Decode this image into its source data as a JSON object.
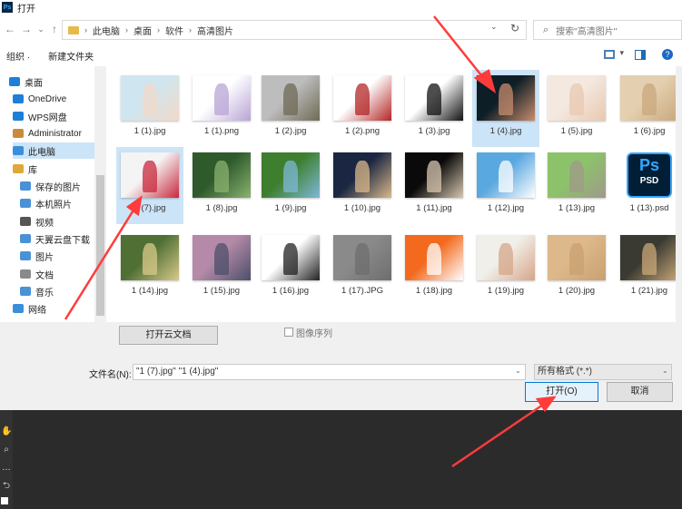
{
  "window": {
    "title": "打开",
    "app_icon": "Ps"
  },
  "address": {
    "breadcrumbs": [
      "此电脑",
      "桌面",
      "软件",
      "高清图片"
    ],
    "search_placeholder": "搜索\"高清图片\""
  },
  "toolbar": {
    "organize": "组织 ·",
    "new_folder": "新建文件夹"
  },
  "sidebar": {
    "items": [
      {
        "label": "桌面",
        "icon": "desktop-icon",
        "color": "#1d7fd8"
      },
      {
        "label": "OneDrive",
        "icon": "cloud-icon",
        "color": "#1d7fd8"
      },
      {
        "label": "WPS网盘",
        "icon": "cloud-icon",
        "color": "#1d7fd8"
      },
      {
        "label": "Administrator",
        "icon": "user-icon",
        "color": "#c98b3b"
      },
      {
        "label": "此电脑",
        "icon": "computer-icon",
        "color": "#3a8fd9"
      },
      {
        "label": "库",
        "icon": "library-icon",
        "color": "#e0a73a"
      },
      {
        "label": "保存的图片",
        "icon": "pictures-icon",
        "color": "#4b91d6"
      },
      {
        "label": "本机照片",
        "icon": "pictures-icon",
        "color": "#4b91d6"
      },
      {
        "label": "视频",
        "icon": "video-icon",
        "color": "#555555"
      },
      {
        "label": "天翼云盘下载",
        "icon": "folder-icon",
        "color": "#4b91d6"
      },
      {
        "label": "图片",
        "icon": "pictures-icon",
        "color": "#4b91d6"
      },
      {
        "label": "文档",
        "icon": "document-icon",
        "color": "#8a8a8a"
      },
      {
        "label": "音乐",
        "icon": "music-icon",
        "color": "#4b91d6"
      },
      {
        "label": "网络",
        "icon": "network-icon",
        "color": "#3a8fd9"
      }
    ]
  },
  "files": [
    {
      "name": "1 (1).jpg",
      "colors": [
        "#cfe6f0",
        "#f2d9c9"
      ],
      "selected": false
    },
    {
      "name": "1 (1).png",
      "colors": [
        "#ffffff",
        "#b8a4d6"
      ],
      "selected": false
    },
    {
      "name": "1 (2).jpg",
      "colors": [
        "#bdbdbd",
        "#6f6a55"
      ],
      "selected": false
    },
    {
      "name": "1 (2).png",
      "colors": [
        "#ffffff",
        "#b32626"
      ],
      "selected": false
    },
    {
      "name": "1 (3).jpg",
      "colors": [
        "#ffffff",
        "#111111"
      ],
      "selected": false
    },
    {
      "name": "1 (4).jpg",
      "colors": [
        "#0d1e26",
        "#c98c6e"
      ],
      "selected": true
    },
    {
      "name": "1 (5).jpg",
      "colors": [
        "#f4e9e0",
        "#e9c8b0"
      ],
      "selected": false
    },
    {
      "name": "1 (6).jpg",
      "colors": [
        "#e4d0b0",
        "#c9a87d"
      ],
      "selected": false
    },
    {
      "name": "1 (7).jpg",
      "colors": [
        "#f4f4f4",
        "#c8283c"
      ],
      "selected": true
    },
    {
      "name": "1 (8).jpg",
      "colors": [
        "#2e5a2c",
        "#8bb26f"
      ],
      "selected": false
    },
    {
      "name": "1 (9).jpg",
      "colors": [
        "#3d7f2e",
        "#7fb8d8"
      ],
      "selected": false
    },
    {
      "name": "1 (10).jpg",
      "colors": [
        "#1b2642",
        "#d9b98a"
      ],
      "selected": false
    },
    {
      "name": "1 (11).jpg",
      "colors": [
        "#0a0a0a",
        "#d8c7b0"
      ],
      "selected": false
    },
    {
      "name": "1 (12).jpg",
      "colors": [
        "#5aa8e0",
        "#ffffff"
      ],
      "selected": false
    },
    {
      "name": "1 (13).jpg",
      "colors": [
        "#8cc36a",
        "#a09a8a"
      ],
      "selected": false
    },
    {
      "name": "1 (13).psd",
      "colors": [
        "#001e36",
        "#31a8ff"
      ],
      "selected": false,
      "psd": true,
      "psd_label": "Ps",
      "psd_sub": "PSD"
    },
    {
      "name": "1 (14).jpg",
      "colors": [
        "#4f6f35",
        "#d9c98a"
      ],
      "selected": false
    },
    {
      "name": "1 (15).jpg",
      "colors": [
        "#b48aa8",
        "#4d4f6a"
      ],
      "selected": false
    },
    {
      "name": "1 (16).jpg",
      "colors": [
        "#ffffff",
        "#222222"
      ],
      "selected": false
    },
    {
      "name": "1 (17).JPG",
      "colors": [
        "#8a8a8a",
        "#6e6e6e"
      ],
      "selected": false
    },
    {
      "name": "1 (18).jpg",
      "colors": [
        "#f36a1e",
        "#ffffff"
      ],
      "selected": false
    },
    {
      "name": "1 (19).jpg",
      "colors": [
        "#f1efe9",
        "#d5a58a"
      ],
      "selected": false
    },
    {
      "name": "1 (20).jpg",
      "colors": [
        "#dcb88a",
        "#caa070"
      ],
      "selected": false
    },
    {
      "name": "1 (21).jpg",
      "colors": [
        "#3a3a32",
        "#c9a878"
      ],
      "selected": false
    }
  ],
  "bottom": {
    "open_cloud": "打开云文档",
    "image_sequence": "图像序列",
    "filename_label": "文件名(N):",
    "filename_value": "\"1 (7).jpg\" \"1 (4).jpg\"",
    "filter": "所有格式 (*.*)",
    "open": "打开(O)",
    "cancel": "取消"
  },
  "accent": {
    "selection": "#cce4f7",
    "primary_border": "#0078d7",
    "annotation": "#ff3b3b"
  }
}
